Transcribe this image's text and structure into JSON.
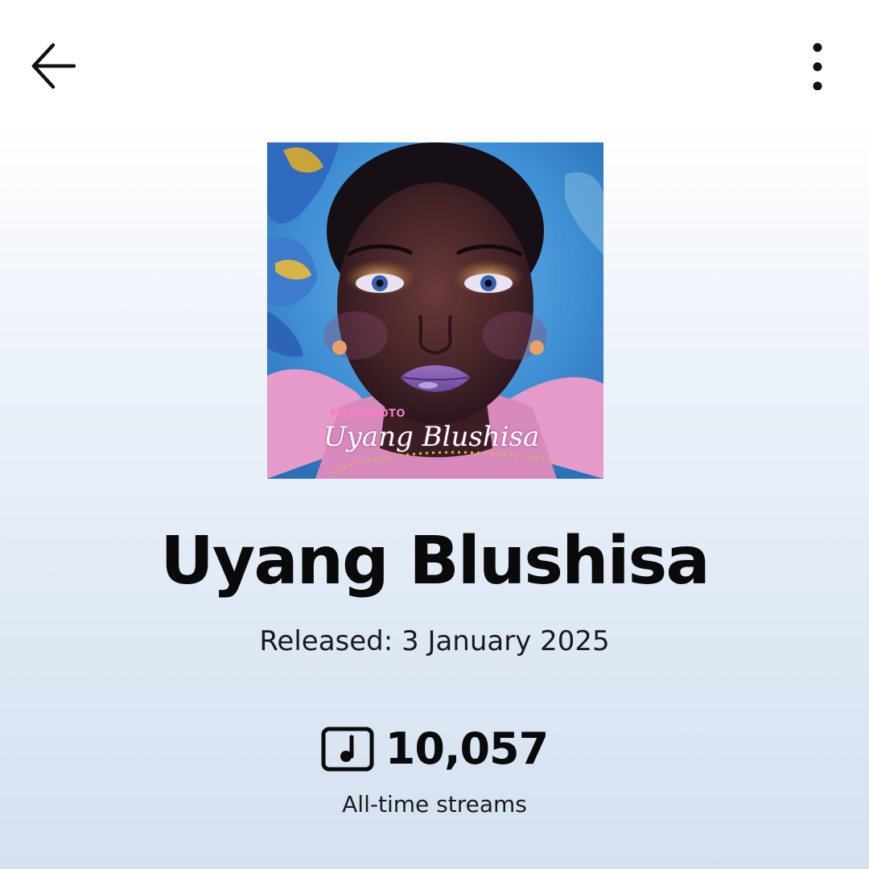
{
  "header": {
    "back_icon": "arrow-left-icon",
    "more_icon": "more-vertical-icon"
  },
  "cover": {
    "artist_text": "MJ WEMOTO",
    "title_text": "Uyang Blushisa"
  },
  "track": {
    "title": "Uyang Blushisa",
    "release_date": "Released: 3 January 2025"
  },
  "stats": {
    "streams_icon": "music-note-icon",
    "streams_count": "10,057",
    "streams_label": "All-time streams"
  },
  "colors": {
    "text": "#0a0a0a",
    "cover_background": "#3f8fd4",
    "cover_artist_text": "#ff78c8"
  }
}
